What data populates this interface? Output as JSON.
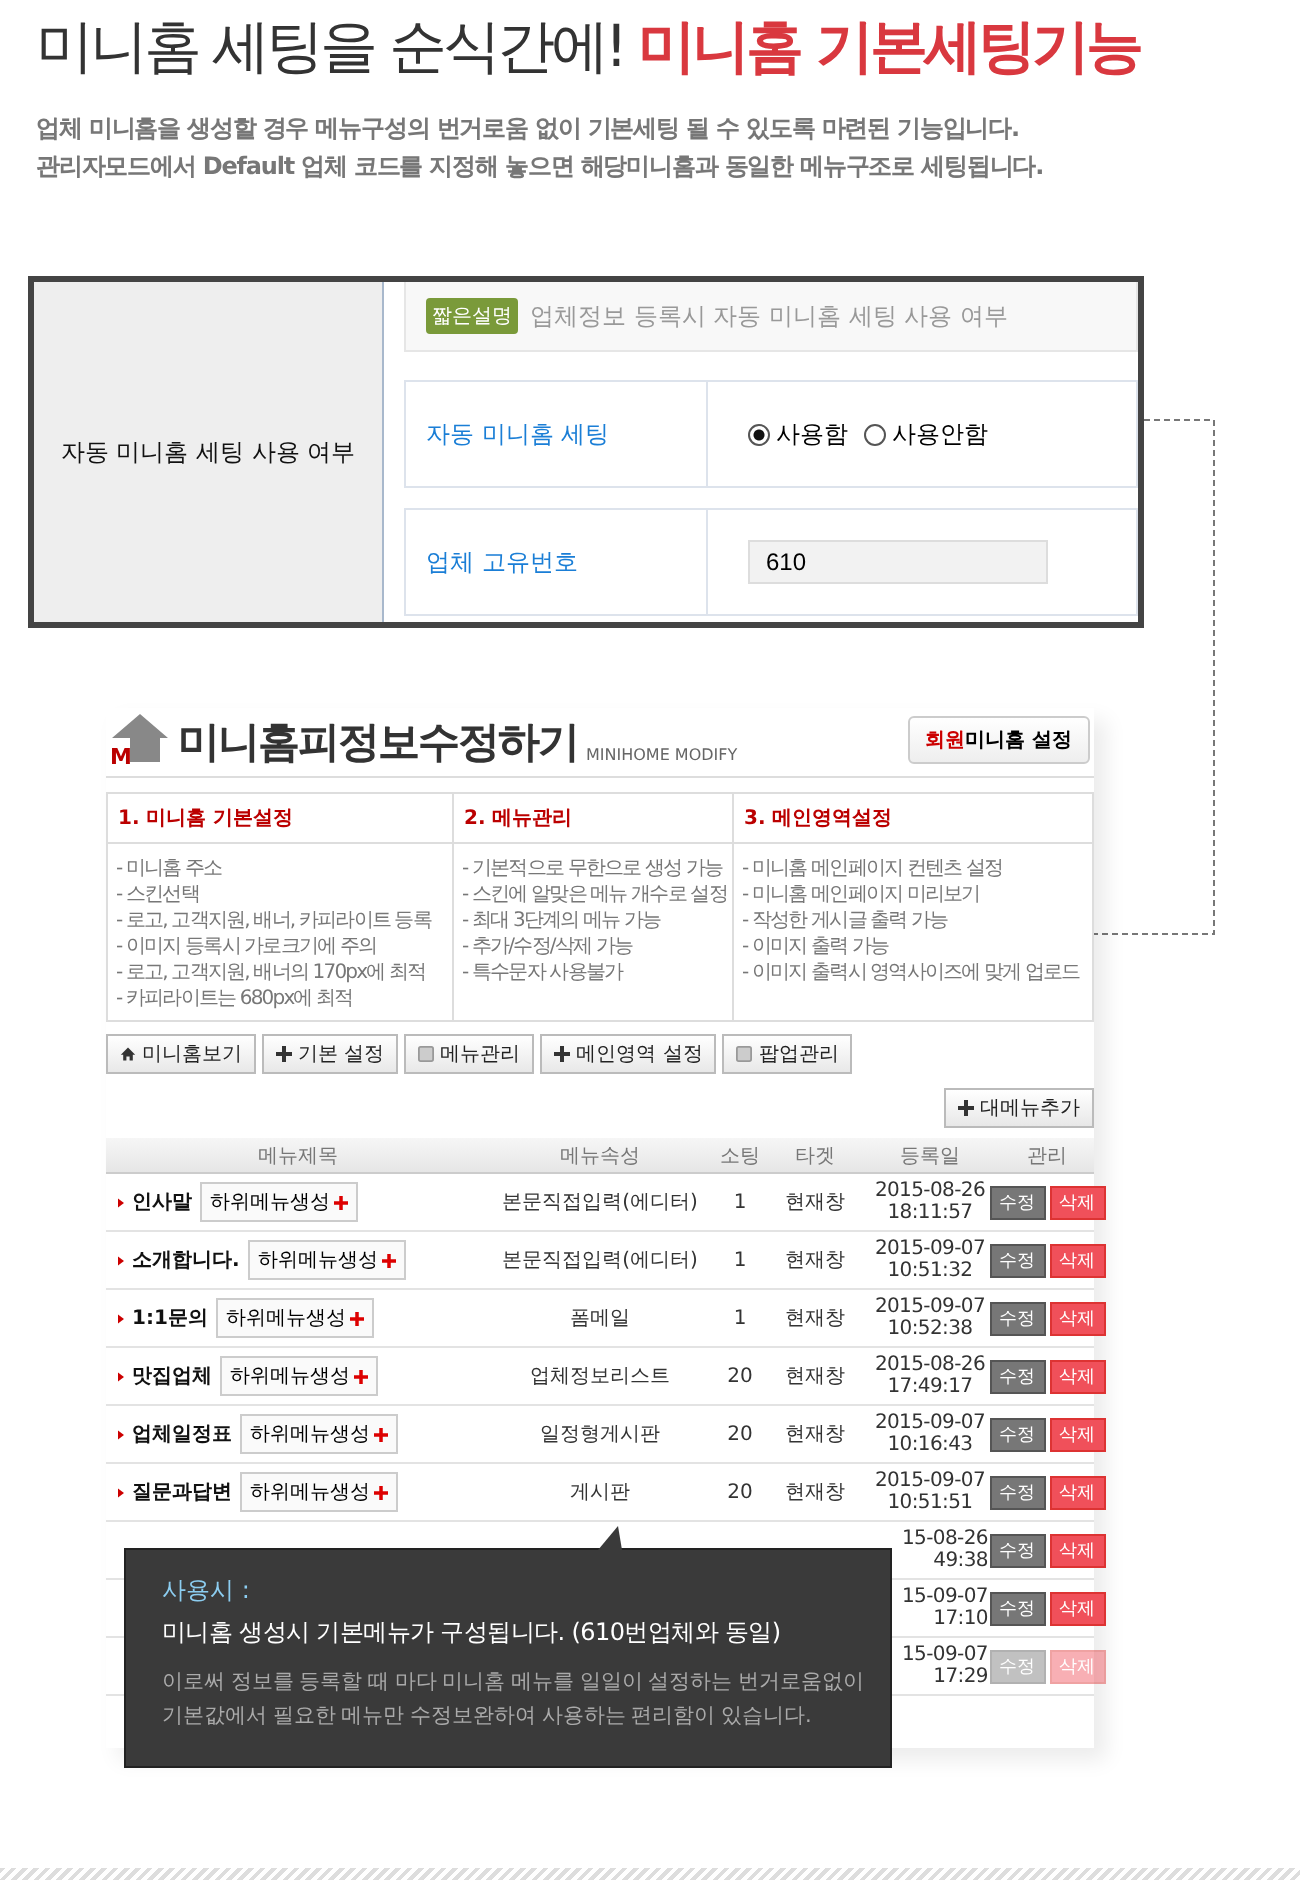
{
  "headline": {
    "plain": "미니홈 세팅을 순식간에!",
    "accent": "미니홈 기본세팅기능"
  },
  "intro": [
    "업체 미니홈을 생성할 경우 메뉴구성의 번거로움 없이 기본세팅 될 수 있도록 마련된 기능입니다.",
    "관리자모드에서 Default 업체 코드를 지정해 놓으면 해당미니홈과 동일한 메뉴구조로 세팅됩니다."
  ],
  "settings_panel": {
    "row_label": "자동 미니홈 세팅 사용 여부",
    "badge": "짧은설명",
    "description": "업체정보 등록시 자동 미니홈 세팅 사용 여부",
    "fields": [
      {
        "kind": "radio",
        "label": "자동 미니홈 세팅",
        "options": [
          {
            "label": "사용함",
            "selected": true
          },
          {
            "label": "사용안함",
            "selected": false
          }
        ]
      },
      {
        "kind": "text",
        "label": "업체 고유번호",
        "value": "610"
      }
    ]
  },
  "admin_screen": {
    "logo_letter": "M",
    "title": "미니홈피정보수정하기",
    "subtitle": "MINIHOME MODIFY",
    "settings_button": {
      "accent": "회원",
      "label": "미니홈 설정"
    },
    "info_columns": [
      {
        "title": "1. 미니홈 기본설정",
        "items": [
          "- 미니홈 주소",
          "- 스킨선택",
          "- 로고, 고객지원, 배너, 카피라이트 등록",
          "- 이미지 등록시 가로크기에 주의",
          "- 로고, 고객지원, 배너의 170px에 최적",
          "- 카피라이트는 680px에 최적"
        ]
      },
      {
        "title": "2. 메뉴관리",
        "items": [
          "- 기본적으로 무한으로 생성 가능",
          "- 스킨에 알맞은 메뉴 개수로 설정",
          "- 최대 3단계의 메뉴 가능",
          "- 추가/수정/삭제 가능",
          "- 특수문자 사용불가"
        ]
      },
      {
        "title": "3. 메인영역설정",
        "items": [
          "- 미니홈 메인페이지 컨텐츠 설정",
          "- 미니홈 메인페이지 미리보기",
          "- 작성한 게시글 출력 가능",
          "- 이미지 출력 가능",
          "- 이미지 출력시 영역사이즈에 맞게 업로드"
        ]
      }
    ],
    "toolbar": [
      {
        "kind": "home",
        "label": "미니홈보기"
      },
      {
        "kind": "plus",
        "label": "기본 설정"
      },
      {
        "kind": "page",
        "label": "메뉴관리"
      },
      {
        "kind": "plus",
        "label": "메인영역 설정"
      },
      {
        "kind": "page",
        "label": "팝업관리"
      }
    ],
    "add_button": {
      "kind": "plus",
      "label": "대메뉴추가"
    },
    "table": {
      "columns": [
        "메뉴제목",
        "메뉴속성",
        "소팅",
        "타겟",
        "등록일",
        "관리"
      ],
      "rows": [
        {
          "kind": "full",
          "title": "인사말",
          "sub_button": "하위메뉴생성",
          "type": "본문직접입력(에디터)",
          "sort": "1",
          "target": "현재창",
          "date": "2015-08-26",
          "time": "18:11:57",
          "edit": "수정",
          "delete": "삭제",
          "disabled": false
        },
        {
          "kind": "full",
          "title": "소개합니다.",
          "sub_button": "하위메뉴생성",
          "type": "본문직접입력(에디터)",
          "sort": "1",
          "target": "현재창",
          "date": "2015-09-07",
          "time": "10:51:32",
          "edit": "수정",
          "delete": "삭제",
          "disabled": false
        },
        {
          "kind": "full",
          "title": "1:1문의",
          "sub_button": "하위메뉴생성",
          "type": "폼메일",
          "sort": "1",
          "target": "현재창",
          "date": "2015-09-07",
          "time": "10:52:38",
          "edit": "수정",
          "delete": "삭제",
          "disabled": false
        },
        {
          "kind": "full",
          "title": "맛집업체",
          "sub_button": "하위메뉴생성",
          "type": "업체정보리스트",
          "sort": "20",
          "target": "현재창",
          "date": "2015-08-26",
          "time": "17:49:17",
          "edit": "수정",
          "delete": "삭제",
          "disabled": false
        },
        {
          "kind": "full",
          "title": "업체일정표",
          "sub_button": "하위메뉴생성",
          "type": "일정형게시판",
          "sort": "20",
          "target": "현재창",
          "date": "2015-09-07",
          "time": "10:16:43",
          "edit": "수정",
          "delete": "삭제",
          "disabled": false
        },
        {
          "kind": "full",
          "title": "질문과답변",
          "sub_button": "하위메뉴생성",
          "type": "게시판",
          "sort": "20",
          "target": "현재창",
          "date": "2015-09-07",
          "time": "10:51:51",
          "edit": "수정",
          "delete": "삭제",
          "disabled": false
        },
        {
          "kind": "covered",
          "date": "15-08-26",
          "time": "49:38",
          "edit": "수정",
          "delete": "삭제",
          "disabled": false
        },
        {
          "kind": "covered",
          "date": "15-09-07",
          "time": "17:10",
          "edit": "수정",
          "delete": "삭제",
          "disabled": false
        },
        {
          "kind": "covered",
          "date": "15-09-07",
          "time": "17:29",
          "edit": "수정",
          "delete": "삭제",
          "disabled": true
        }
      ]
    }
  },
  "tooltip": {
    "heading": "사용시 :",
    "main": "미니홈 생성시 기본메뉴가 구성됩니다. (610번업체와 동일)",
    "detail": [
      "이로써 정보를 등록할 때 마다 미니홈 메뉴를 일일이 설정하는 번거로움없이",
      "기본값에서 필요한 메뉴만 수정보완하여 사용하는 편리함이 있습니다."
    ]
  }
}
